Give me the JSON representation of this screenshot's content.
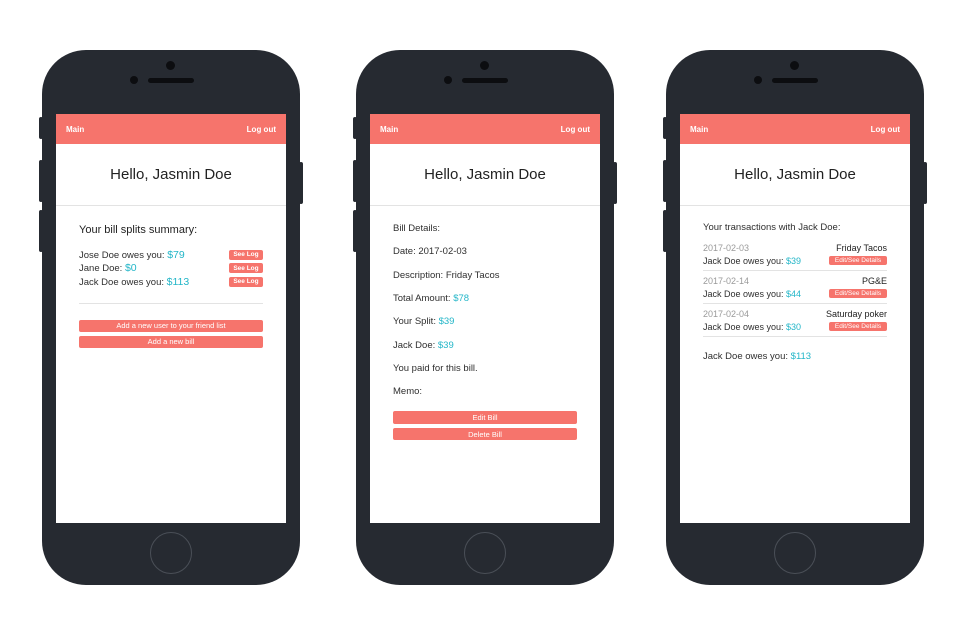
{
  "nav": {
    "main_label": "Main",
    "logout_label": "Log out"
  },
  "greeting": "Hello, Jasmin Doe",
  "summary": {
    "title": "Your bill splits summary:",
    "rows": [
      {
        "label": "Jose Doe owes you: ",
        "amount": "$79",
        "button": "See Log"
      },
      {
        "label": "Jane Doe: ",
        "amount": "$0",
        "button": "See Log"
      },
      {
        "label": "Jack Doe owes you: ",
        "amount": "$113",
        "button": "See Log"
      }
    ],
    "add_user_label": "Add a new user to your friend list",
    "add_bill_label": "Add a new bill"
  },
  "bill": {
    "heading": "Bill Details:",
    "date_label": "Date: ",
    "date": "2017-02-03",
    "desc_label": "Description: ",
    "desc": "Friday Tacos",
    "total_label": "Total Amount: ",
    "total": "$78",
    "split_label": "Your Split: ",
    "split": "$39",
    "other_label": "Jack Doe: ",
    "other": "$39",
    "paid_text": "You paid for this bill.",
    "memo_label": "Memo:",
    "edit_label": "Edit Bill",
    "delete_label": "Delete Bill"
  },
  "transactions": {
    "title": "Your transactions with Jack Doe:",
    "items": [
      {
        "date": "2017-02-03",
        "name": "Friday Tacos",
        "owes_label": "Jack Doe owes you: ",
        "amount": "$39",
        "button": "Edit/See Details"
      },
      {
        "date": "2017-02-14",
        "name": "PG&E",
        "owes_label": "Jack Doe owes you: ",
        "amount": "$44",
        "button": "Edit/See Details"
      },
      {
        "date": "2017-02-04",
        "name": "Saturday poker",
        "owes_label": "Jack Doe owes you: ",
        "amount": "$30",
        "button": "Edit/See Details"
      }
    ],
    "total_label": "Jack Doe owes you: ",
    "total": "$113"
  },
  "colors": {
    "accent": "#f6746c",
    "money": "#23b6c8",
    "phone_body": "#262a31"
  }
}
